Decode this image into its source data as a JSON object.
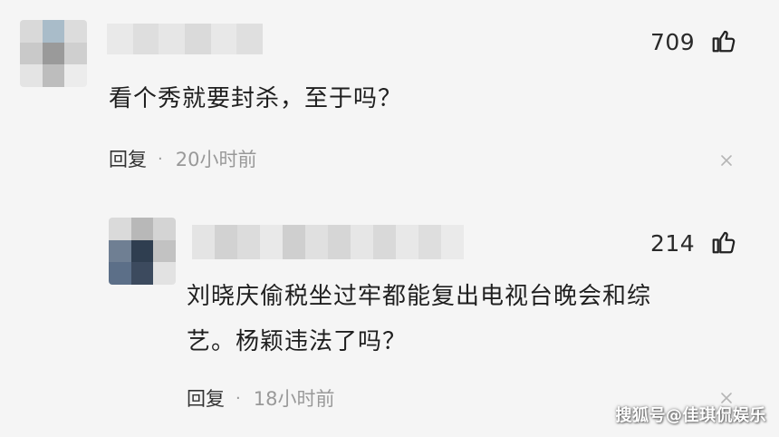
{
  "comments": [
    {
      "likes": "709",
      "text_lines": [
        "看个秀就要封杀，至于吗？"
      ],
      "reply_label": "回复",
      "separator": "·",
      "time": "20小时前"
    },
    {
      "likes": "214",
      "text_lines": [
        "刘晓庆偷税坐过牢都能复出电视台晚会和综",
        "艺。杨颖违法了吗？"
      ],
      "reply_label": "回复",
      "separator": "·",
      "time": "18小时前"
    }
  ],
  "icons": {
    "like": "thumbs-up-icon",
    "close": "close-icon"
  },
  "watermark": "搜狐号@佳琪侃娱乐",
  "colors": {
    "background": "#f5f5f5",
    "text": "#1f1f1f",
    "meta_time": "#999999"
  }
}
